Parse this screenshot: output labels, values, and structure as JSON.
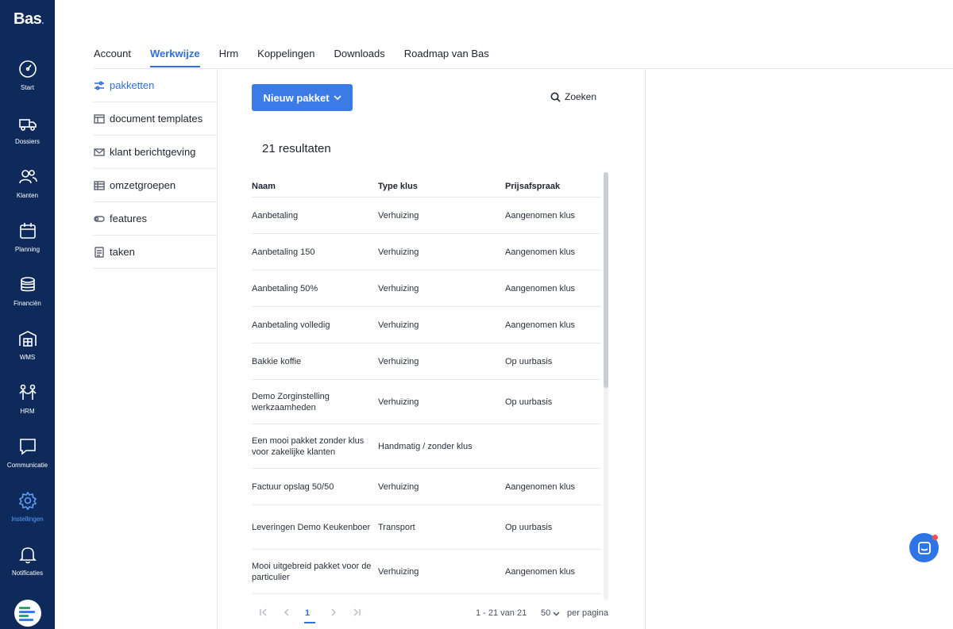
{
  "brand": {
    "name": "Bas",
    "dot": "."
  },
  "rail": {
    "items": [
      {
        "label": "Start",
        "icon": "gauge-icon"
      },
      {
        "label": "Dossiers",
        "icon": "truck-icon"
      },
      {
        "label": "Klanten",
        "icon": "users-icon"
      },
      {
        "label": "Planning",
        "icon": "calendar-icon"
      },
      {
        "label": "Financiën",
        "icon": "coins-icon"
      },
      {
        "label": "WMS",
        "icon": "warehouse-icon"
      },
      {
        "label": "HRM",
        "icon": "people-icon"
      },
      {
        "label": "Communicatie",
        "icon": "chat-icon"
      },
      {
        "label": "Instellingen",
        "icon": "gear-icon",
        "active": true
      },
      {
        "label": "Notificaties",
        "icon": "bell-icon"
      }
    ]
  },
  "tabs": [
    "Account",
    "Werkwijze",
    "Hrm",
    "Koppelingen",
    "Downloads",
    "Roadmap van Bas"
  ],
  "active_tab": "Werkwijze",
  "subnav": [
    {
      "label": "pakketten",
      "icon": "sliders-icon",
      "active": true
    },
    {
      "label": "document templates",
      "icon": "template-icon"
    },
    {
      "label": "klant berichtgeving",
      "icon": "mail-icon"
    },
    {
      "label": "omzetgroepen",
      "icon": "table-icon"
    },
    {
      "label": "features",
      "icon": "toggle-icon"
    },
    {
      "label": "taken",
      "icon": "checklist-icon"
    }
  ],
  "toolbar": {
    "new_label": "Nieuw pakket",
    "search_label": "Zoeken"
  },
  "results_label": "21 resultaten",
  "table": {
    "headers": [
      "Naam",
      "Type klus",
      "Prijsafspraak"
    ],
    "rows": [
      [
        "Aanbetaling",
        "Verhuizing",
        "Aangenomen klus"
      ],
      [
        "Aanbetaling 150",
        "Verhuizing",
        "Aangenomen klus"
      ],
      [
        "Aanbetaling 50%",
        "Verhuizing",
        "Aangenomen klus"
      ],
      [
        "Aanbetaling volledig",
        "Verhuizing",
        "Aangenomen klus"
      ],
      [
        "Bakkie koffie",
        "Verhuizing",
        "Op uurbasis"
      ],
      [
        "Demo Zorginstelling werkzaamheden",
        "Verhuizing",
        "Op uurbasis"
      ],
      [
        "Een mooi pakket zonder klus voor zakelijke klanten",
        "Handmatig / zonder klus",
        ""
      ],
      [
        "Factuur opslag 50/50",
        "Verhuizing",
        "Aangenomen klus"
      ],
      [
        "Leveringen Demo Keukenboer",
        "Transport",
        "Op uurbasis"
      ],
      [
        "Mooi uitgebreid pakket voor de particulier",
        "Verhuizing",
        "Aangenomen klus"
      ]
    ]
  },
  "pager": {
    "page": "1",
    "range": "1 - 21 van 21",
    "per_page_value": "50",
    "per_page_label": "per pagina"
  },
  "colors": {
    "sidebar": "#0d2a5a",
    "accent": "#2f6fe0",
    "button": "#3b7be6"
  }
}
